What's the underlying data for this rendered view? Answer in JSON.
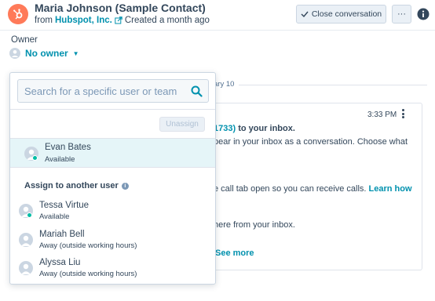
{
  "header": {
    "contact_name": "Maria Johnson (Sample Contact)",
    "from_prefix": "from",
    "company": "Hubspot, Inc.",
    "created": "Created a month ago",
    "close_button": "Close conversation",
    "more_label": "···",
    "logo_icon": "hubspot-sprocket-icon",
    "brand_color": "#ff7a59"
  },
  "owner": {
    "label": "Owner",
    "value": "No owner"
  },
  "conversation": {
    "date_fragment": "ary 10",
    "time": "3:33 PM",
    "lines": {
      "l1_link": "1733)",
      "l1_bold": " to your inbox.",
      "l2": "pear in your inbox as a conversation. Choose what",
      "l3_text": "e call tab open so you can receive calls. ",
      "l3_link": "Learn how",
      "l4": "here from your inbox.",
      "see_more": "See more"
    }
  },
  "dropdown": {
    "search_placeholder": "Search for a specific user or team",
    "unassign_label": "Unassign",
    "current_user": {
      "name": "Evan Bates",
      "status": "Available"
    },
    "section_title": "Assign to another user",
    "users": [
      {
        "name": "Tessa Virtue",
        "status": "Available"
      },
      {
        "name": "Mariah Bell",
        "status": "Away (outside working hours)"
      },
      {
        "name": "Alyssa Liu",
        "status": "Away (outside working hours)"
      }
    ]
  },
  "colors": {
    "link": "#0091ae",
    "text": "#33475b",
    "available": "#00bda5",
    "selected_row": "#e5f5f8"
  }
}
